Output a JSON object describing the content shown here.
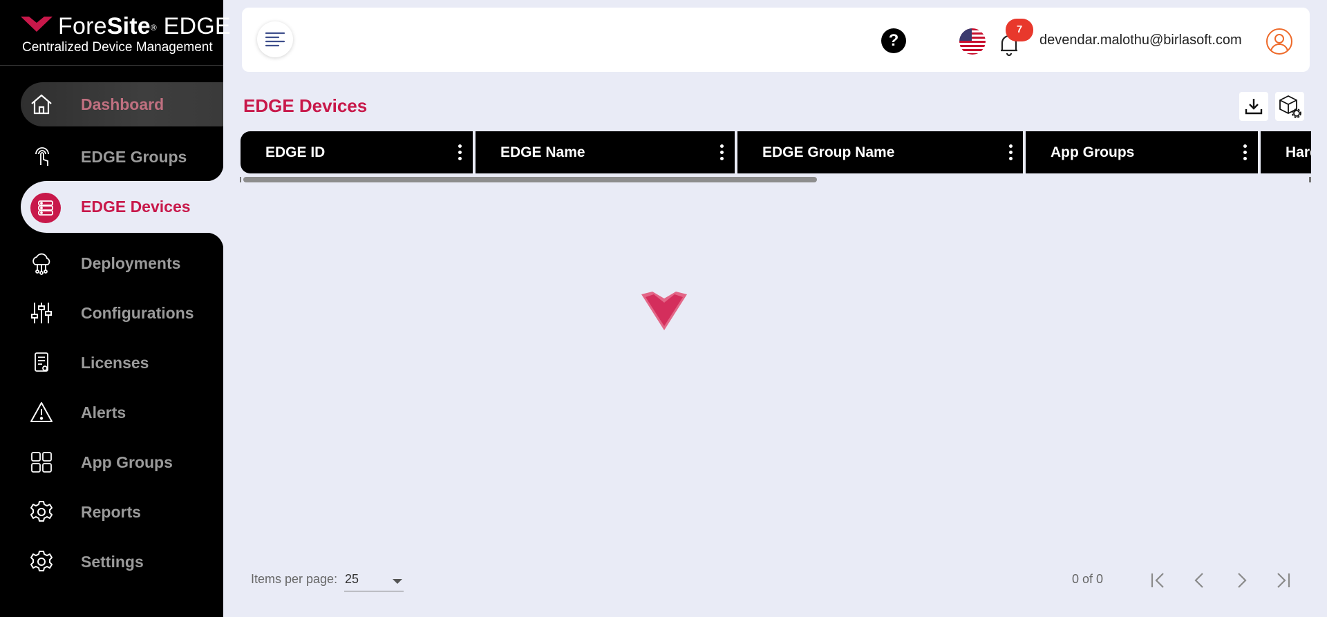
{
  "brand": {
    "name_light": "Fore",
    "name_bold": "Site",
    "registered": "®",
    "name_suffix": "EDGE",
    "subtitle": "Centralized Device Management",
    "accent_color": "#c8184a"
  },
  "sidebar": {
    "items": [
      {
        "label": "Dashboard",
        "icon": "home-icon"
      },
      {
        "label": "EDGE Groups",
        "icon": "touch-icon"
      },
      {
        "label": "EDGE Devices",
        "icon": "server-icon"
      },
      {
        "label": "Deployments",
        "icon": "cloud-network-icon"
      },
      {
        "label": "Configurations",
        "icon": "sliders-icon"
      },
      {
        "label": "Licenses",
        "icon": "license-icon"
      },
      {
        "label": "Alerts",
        "icon": "warning-icon"
      },
      {
        "label": "App Groups",
        "icon": "grid-icon"
      },
      {
        "label": "Reports",
        "icon": "gear-icon"
      },
      {
        "label": "Settings",
        "icon": "gear-icon"
      }
    ]
  },
  "header": {
    "help_label": "?",
    "notification_count": "7",
    "user_email": "devendar.malothu@birlasoft.com"
  },
  "main": {
    "title": "EDGE Devices",
    "table": {
      "columns": [
        "EDGE ID",
        "EDGE Name",
        "EDGE Group Name",
        "App Groups",
        "Hard"
      ]
    }
  },
  "paginator": {
    "items_per_page_label": "Items per page:",
    "items_per_page_value": "25",
    "range_label": "0 of 0"
  }
}
